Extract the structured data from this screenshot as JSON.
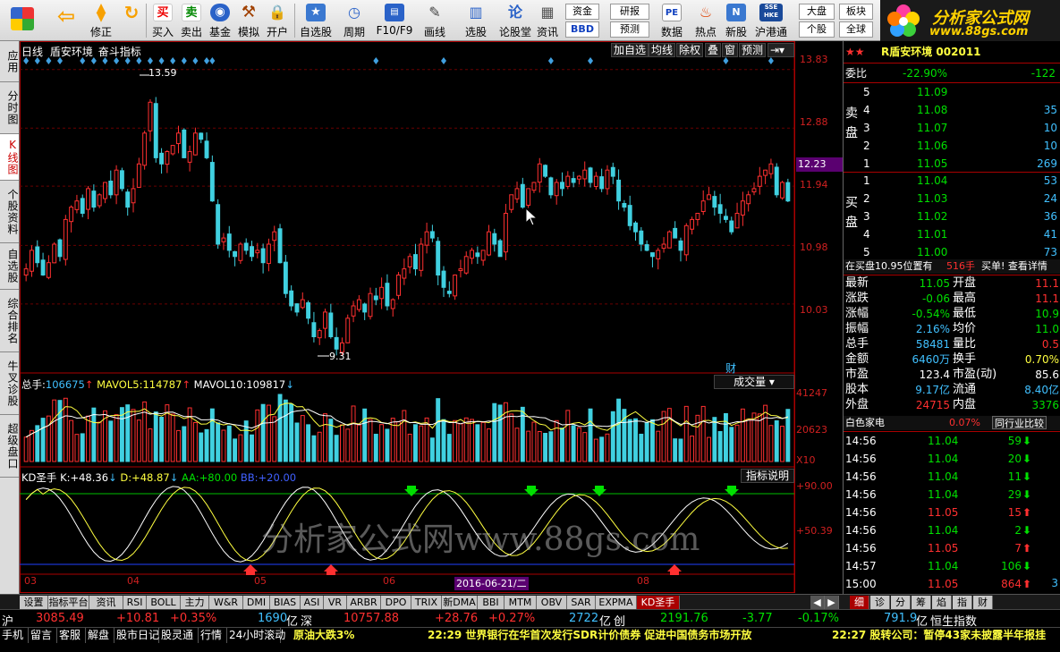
{
  "toolbar": {
    "buttons": [
      {
        "label": "",
        "icon": "windows-icon"
      },
      {
        "label": "",
        "icon": "back-arrow-icon"
      },
      {
        "label": "修正",
        "icon": "updown-arrows-icon"
      },
      {
        "label": "",
        "icon": "refresh-icon"
      },
      {
        "label": "买入",
        "icon": "buy-icon"
      },
      {
        "label": "卖出",
        "icon": "sell-icon"
      },
      {
        "label": "基金",
        "icon": "fund-icon"
      },
      {
        "label": "模拟",
        "icon": "hammer-icon"
      },
      {
        "label": "开户",
        "icon": "lock-icon"
      },
      {
        "label": "自选股",
        "icon": "star-icon"
      },
      {
        "label": "周期",
        "icon": "clock-icon"
      },
      {
        "label": "F10/F9",
        "icon": "f10-icon"
      },
      {
        "label": "画线",
        "icon": "pen-icon"
      },
      {
        "label": "选股",
        "icon": "filter-icon"
      },
      {
        "label": "论股堂",
        "icon": "forum-icon"
      },
      {
        "label": "资讯",
        "icon": "news-icon"
      },
      {
        "label": "资金",
        "icon": ""
      },
      {
        "label": "BBD",
        "icon": ""
      },
      {
        "label": "研报",
        "icon": ""
      },
      {
        "label": "预测",
        "icon": ""
      },
      {
        "label": "数据",
        "icon": "pe-icon"
      },
      {
        "label": "热点",
        "icon": "fire-icon"
      },
      {
        "label": "新股",
        "icon": "new-stock-icon"
      },
      {
        "label": "沪港通",
        "icon": "hk-icon"
      },
      {
        "label": "大盘",
        "icon": ""
      },
      {
        "label": "板块",
        "icon": ""
      },
      {
        "label": "个股",
        "icon": ""
      },
      {
        "label": "全球",
        "icon": ""
      }
    ],
    "buy_char": "买",
    "sell_char": "卖",
    "pe_text": "PE",
    "hk_text": "SSE HKE"
  },
  "logo": {
    "title": "分析家公式网",
    "url": "www.88gs.com"
  },
  "left_tabs": [
    "应用",
    "分时图",
    "K线图",
    "个股资料",
    "自选股",
    "综合排名",
    "牛叉诊股",
    "超级盘口"
  ],
  "chart": {
    "header": {
      "period": "日线",
      "name": "盾安环境",
      "indicator": "奋斗指标"
    },
    "header_buttons": [
      "加自选",
      "均线",
      "除权",
      "叠",
      "窗",
      "预测"
    ],
    "price_ticks": [
      "13.83",
      "12.88",
      "11.94",
      "10.98",
      "10.03"
    ],
    "current_price_tag": "12.23",
    "high_label": "13.59",
    "low_label": "9.31",
    "cai_label": "财",
    "volume_header": {
      "label": "总手:",
      "value": "106675",
      "mavol5_label": "MAVOL5:",
      "mavol5": "114787",
      "mavol10_label": "MAVOL10:",
      "mavol10": "109817"
    },
    "volume_dropdown": "成交量",
    "volume_ticks": [
      "41247",
      "20623",
      "X10"
    ],
    "kd_header": {
      "label": "KD圣手",
      "k_label": "K:",
      "k": "+48.36",
      "d_label": "D:",
      "d": "+48.87",
      "aa_label": "AA:",
      "aa": "+80.00",
      "bb_label": "BB:",
      "bb": "+20.00"
    },
    "kd_button": "指标说明",
    "kd_ticks": [
      "+90.00",
      "+50.39"
    ],
    "x_labels": [
      "03",
      "04",
      "05",
      "06",
      "08"
    ],
    "date_tag": "2016-06-21/二",
    "watermark": "分析家公式网www.88gs.com"
  },
  "chart_data": {
    "type": "candlestick",
    "ylim": [
      9.0,
      14.0
    ],
    "close": [
      10.6,
      10.9,
      10.7,
      10.5,
      10.7,
      11.0,
      10.8,
      11.4,
      11.6,
      11.7,
      11.5,
      11.9,
      11.6,
      11.8,
      12.0,
      11.8,
      12.2,
      11.9,
      11.6,
      11.9,
      12.3,
      12.8,
      13.3,
      12.4,
      12.3,
      12.5,
      12.6,
      12.8,
      12.4,
      12.5,
      12.8,
      12.7,
      12.4,
      11.7,
      11.0,
      11.1,
      10.9,
      10.8,
      11.0,
      10.9,
      10.8,
      10.9,
      10.7,
      11.0,
      11.2,
      10.7,
      10.2,
      10.0,
      9.9,
      10.1,
      9.8,
      9.5,
      9.6,
      9.9,
      9.5,
      9.3,
      9.4,
      9.8,
      10.0,
      10.1,
      9.9,
      10.2,
      10.1,
      10.3,
      10.0,
      10.1,
      10.5,
      10.6,
      10.8,
      10.6,
      11.0,
      11.2,
      11.1,
      10.5,
      10.3,
      10.2,
      10.5,
      10.6,
      10.8,
      10.9,
      10.8,
      10.9,
      11.2,
      11.0,
      10.8,
      11.5,
      11.8,
      11.9,
      11.6,
      11.9,
      12.0,
      12.3,
      12.1,
      11.8,
      12.0,
      11.9,
      12.1,
      12.0,
      12.1,
      12.2,
      12.0,
      12.1,
      11.9,
      12.2,
      12.1,
      11.7,
      11.6,
      11.3,
      11.2,
      11.0,
      10.9,
      10.8,
      10.9,
      11.0,
      11.2,
      11.1,
      10.9,
      11.3,
      11.4,
      11.5,
      11.7,
      11.8,
      11.6,
      11.5,
      11.4,
      11.2,
      11.5,
      11.7,
      11.8,
      11.9,
      12.1,
      12.2,
      12.3,
      11.8,
      12.0,
      11.7
    ],
    "volume_ticks": [
      41247,
      20623
    ]
  },
  "quote": {
    "stars": "★★",
    "code_name": "R盾安环境 002011",
    "weibi_label": "委比",
    "weibi": "-22.90%",
    "weicha": "-122",
    "sell_label": "卖盘",
    "buy_label": "买盘",
    "asks": [
      {
        "lv": "5",
        "p": "11.09",
        "v": ""
      },
      {
        "lv": "4",
        "p": "11.08",
        "v": "35"
      },
      {
        "lv": "3",
        "p": "11.07",
        "v": "10"
      },
      {
        "lv": "2",
        "p": "11.06",
        "v": "10"
      },
      {
        "lv": "1",
        "p": "11.05",
        "v": "269"
      }
    ],
    "bids": [
      {
        "lv": "1",
        "p": "11.04",
        "v": "53"
      },
      {
        "lv": "2",
        "p": "11.03",
        "v": "24"
      },
      {
        "lv": "3",
        "p": "11.02",
        "v": "36"
      },
      {
        "lv": "4",
        "p": "11.01",
        "v": "41"
      },
      {
        "lv": "5",
        "p": "11.00",
        "v": "73"
      }
    ],
    "pos_line": {
      "t1": "在买盘10.95位置有",
      "v": "516手",
      "t2": "买单! 查看详情"
    },
    "stats": [
      {
        "k1": "最新",
        "v1": "11.05",
        "k2": "开盘",
        "v2": "11.1"
      },
      {
        "k1": "涨跌",
        "v1": "-0.06",
        "k2": "最高",
        "v2": "11.1"
      },
      {
        "k1": "涨幅",
        "v1": "-0.54%",
        "k2": "最低",
        "v2": "10.9"
      },
      {
        "k1": "振幅",
        "v1": "2.16%",
        "k2": "均价",
        "v2": "11.0"
      },
      {
        "k1": "总手",
        "v1": "58481",
        "k2": "量比",
        "v2": "0.5"
      },
      {
        "k1": "金额",
        "v1": "6460万",
        "k2": "换手",
        "v2": "0.70%"
      },
      {
        "k1": "市盈",
        "v1": "123.4",
        "k2": "市盈(动)",
        "v2": "85.6"
      },
      {
        "k1": "股本",
        "v1": "9.17亿",
        "k2": "流通",
        "v2": "8.40亿"
      },
      {
        "k1": "外盘",
        "v1": "24715",
        "k2": "内盘",
        "v2": "3376"
      }
    ],
    "sector": {
      "name": "白色家电",
      "pct": "0.07%",
      "btn": "同行业比较"
    },
    "ticks": [
      {
        "t": "14:56",
        "p": "11.04",
        "v": "59",
        "d": "down"
      },
      {
        "t": "14:56",
        "p": "11.04",
        "v": "20",
        "d": "down"
      },
      {
        "t": "14:56",
        "p": "11.04",
        "v": "11",
        "d": "down"
      },
      {
        "t": "14:56",
        "p": "11.04",
        "v": "29",
        "d": "down"
      },
      {
        "t": "14:56",
        "p": "11.05",
        "v": "15",
        "d": "up"
      },
      {
        "t": "14:56",
        "p": "11.04",
        "v": "2",
        "d": "down"
      },
      {
        "t": "14:56",
        "p": "11.05",
        "v": "7",
        "d": "up"
      },
      {
        "t": "14:57",
        "p": "11.04",
        "v": "106",
        "d": "down"
      },
      {
        "t": "15:00",
        "p": "11.05",
        "v": "864",
        "d": "up"
      }
    ],
    "tick_cut": "3"
  },
  "bottom_tabs": [
    "设置",
    "指标平台",
    "资讯",
    "RSI",
    "BOLL",
    "主力",
    "W&R",
    "DMI",
    "BIAS",
    "ASI",
    "VR",
    "ARBR",
    "DPO",
    "TRIX",
    "新DMA",
    "BBI",
    "MTM",
    "OBV",
    "SAR",
    "EXPMA",
    "KD圣手"
  ],
  "right_tabs": [
    "细",
    "诊",
    "分",
    "筹",
    "焰",
    "指",
    "财"
  ],
  "market": [
    {
      "name": "沪",
      "idx": "3085.49",
      "chg": "+10.81",
      "pct": "+0.35%",
      "amt": "1690",
      "unit": "亿"
    },
    {
      "name": "深",
      "idx": "10757.88",
      "chg": "+28.76",
      "pct": "+0.27%",
      "amt": "2722",
      "unit": "亿"
    },
    {
      "name": "创",
      "idx": "2191.76",
      "chg": "-3.77",
      "pct": "-0.17%",
      "amt": "791.9",
      "unit": "亿"
    }
  ],
  "hsi_label": "恒生指数",
  "status_tabs": [
    "手机",
    "留言",
    "客服",
    "解盘",
    "股市日记",
    "股灵通",
    "行情",
    "24小时滚动"
  ],
  "news": {
    "n1": "原油大跌3%",
    "n2": "22:29 世界银行在华首次发行SDR计价债券 促进中国债务市场开放",
    "n3": "22:27 股转公司：暂停43家未披露半年报挂"
  }
}
